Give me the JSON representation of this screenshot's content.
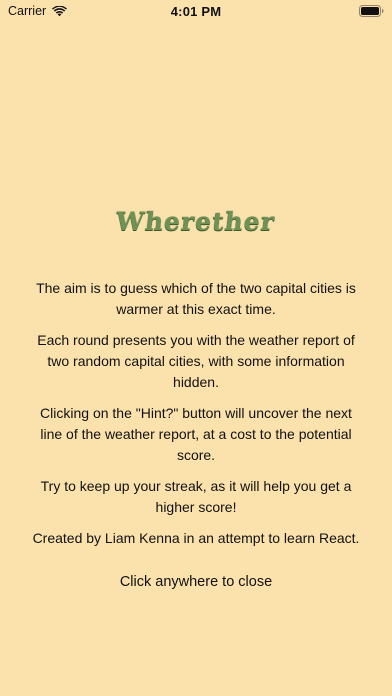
{
  "status": {
    "carrier": "Carrier",
    "time": "4:01 PM"
  },
  "colors": {
    "background": "#fbe2ad",
    "logo": "#6f9155",
    "text": "#111111"
  },
  "app": {
    "title": "Wherether"
  },
  "about": {
    "p1": "The aim is to guess which of the two capital cities is warmer at this exact time.",
    "p2": "Each round presents you with the weather report of two random capital cities, with some information hidden.",
    "p3": "Clicking on the \"Hint?\" button will uncover the next line of the weather report, at a cost to the potential score.",
    "p4": "Try to keep up your streak, as it will help you get a higher score!",
    "p5": "Created by Liam Kenna in an attempt to learn React."
  },
  "close_hint": "Click anywhere to close",
  "icons": {
    "wifi": "wifi-icon",
    "battery": "battery-icon"
  }
}
